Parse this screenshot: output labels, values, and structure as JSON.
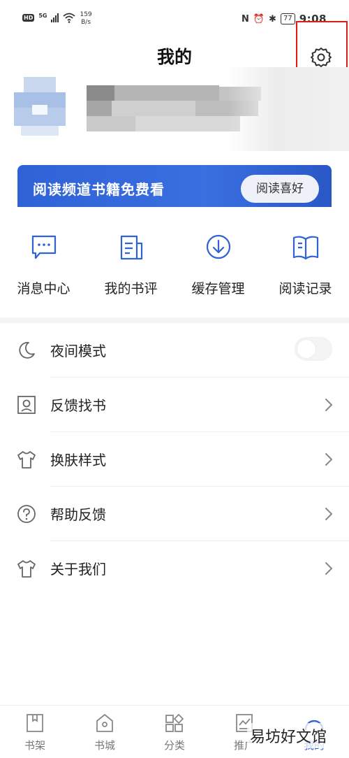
{
  "status_bar": {
    "hd": "HD",
    "network": "5G",
    "speed_value": "159",
    "speed_unit": "B/s",
    "battery": "77",
    "time": "9:08"
  },
  "header": {
    "title": "我的"
  },
  "banner": {
    "title": "阅读频道书籍免费看",
    "button": "阅读喜好",
    "color": "#2f62d6"
  },
  "quick_actions": [
    {
      "label": "消息中心",
      "icon": "message-icon"
    },
    {
      "label": "我的书评",
      "icon": "book-review-icon"
    },
    {
      "label": "缓存管理",
      "icon": "download-icon"
    },
    {
      "label": "阅读记录",
      "icon": "open-book-icon"
    }
  ],
  "menu": [
    {
      "label": "夜间模式",
      "icon": "moon-icon",
      "toggle": false
    },
    {
      "label": "反馈找书",
      "icon": "search-book-icon"
    },
    {
      "label": "换肤样式",
      "icon": "shirt-icon"
    },
    {
      "label": "帮助反馈",
      "icon": "help-icon"
    },
    {
      "label": "关于我们",
      "icon": "shirt-icon"
    }
  ],
  "bottom_nav": [
    {
      "label": "书架",
      "icon": "bookshelf-icon"
    },
    {
      "label": "书城",
      "icon": "store-icon"
    },
    {
      "label": "分类",
      "icon": "category-icon"
    },
    {
      "label": "推广",
      "icon": "promo-icon"
    },
    {
      "label": "我的",
      "icon": "profile-icon",
      "active": true
    }
  ],
  "watermark": "易坊好文馆",
  "colors": {
    "accent": "#3464d8",
    "highlight": "#e01b1b"
  }
}
